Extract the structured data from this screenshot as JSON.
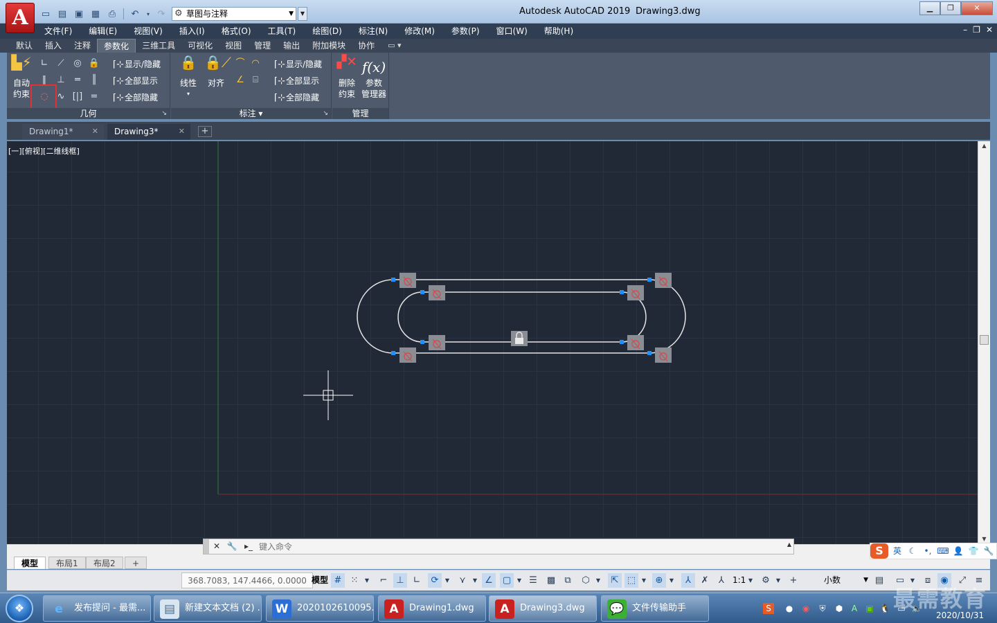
{
  "titlebar": {
    "logo": "A",
    "workspace": "草图与注释",
    "app_title": "Autodesk AutoCAD 2019",
    "doc_title": "Drawing3.dwg"
  },
  "menu": {
    "items": [
      "文件(F)",
      "编辑(E)",
      "视图(V)",
      "插入(I)",
      "格式(O)",
      "工具(T)",
      "绘图(D)",
      "标注(N)",
      "修改(M)",
      "参数(P)",
      "窗口(W)",
      "帮助(H)"
    ]
  },
  "ribbon_tabs": {
    "items": [
      "默认",
      "插入",
      "注释",
      "参数化",
      "三维工具",
      "可视化",
      "视图",
      "管理",
      "输出",
      "附加模块",
      "协作"
    ],
    "active": "参数化"
  },
  "ribbon": {
    "geometry_panel": {
      "title": "几何",
      "auto_constrain": [
        "自动",
        "约束"
      ],
      "show_hide": "显示/隐藏",
      "show_all": "全部显示",
      "hide_all": "全部隐藏"
    },
    "dimension_panel": {
      "title": "标注",
      "linear": "线性",
      "aligned": "对齐",
      "show_hide": "显示/隐藏",
      "show_all": "全部显示",
      "hide_all": "全部隐藏"
    },
    "manage_panel": {
      "title": "管理",
      "delete_constraints": [
        "删除",
        "约束"
      ],
      "param_manager": [
        "参数",
        "管理器"
      ],
      "fx": "f(x)"
    }
  },
  "doc_tabs": {
    "items": [
      "Drawing1*",
      "Drawing3*"
    ],
    "active": "Drawing3*"
  },
  "viewport": {
    "label": "[一][俯视][二维线框]"
  },
  "drawing": {
    "background": "#212836",
    "grid_color": "#2a3344",
    "line_color": "#e6e6e6",
    "grip_color": "#1e90ff",
    "constraint_badge_color": "#8a8d93"
  },
  "command_line": {
    "placeholder": "键入命令"
  },
  "layout_tabs": {
    "items": [
      "模型",
      "布局1",
      "布局2"
    ],
    "active": "模型"
  },
  "status": {
    "coords": "368.7083, 147.4466, 0.0000",
    "model": "模型",
    "scale": "1:1",
    "units": "小数"
  },
  "ime": {
    "mode": "英"
  },
  "taskbar": {
    "items": [
      {
        "label": "发布提问 - 最需...",
        "icon": "ie-icon"
      },
      {
        "label": "新建文本文档 (2) ...",
        "icon": "notepad-icon"
      },
      {
        "label": "2020102610095...",
        "icon": "word-icon"
      },
      {
        "label": "Drawing1.dwg",
        "icon": "autocad-icon"
      },
      {
        "label": "Drawing3.dwg",
        "icon": "autocad-icon"
      },
      {
        "label": "文件传输助手",
        "icon": "wechat-icon"
      }
    ],
    "date": "2020/10/31",
    "watermark": "最需教育"
  }
}
